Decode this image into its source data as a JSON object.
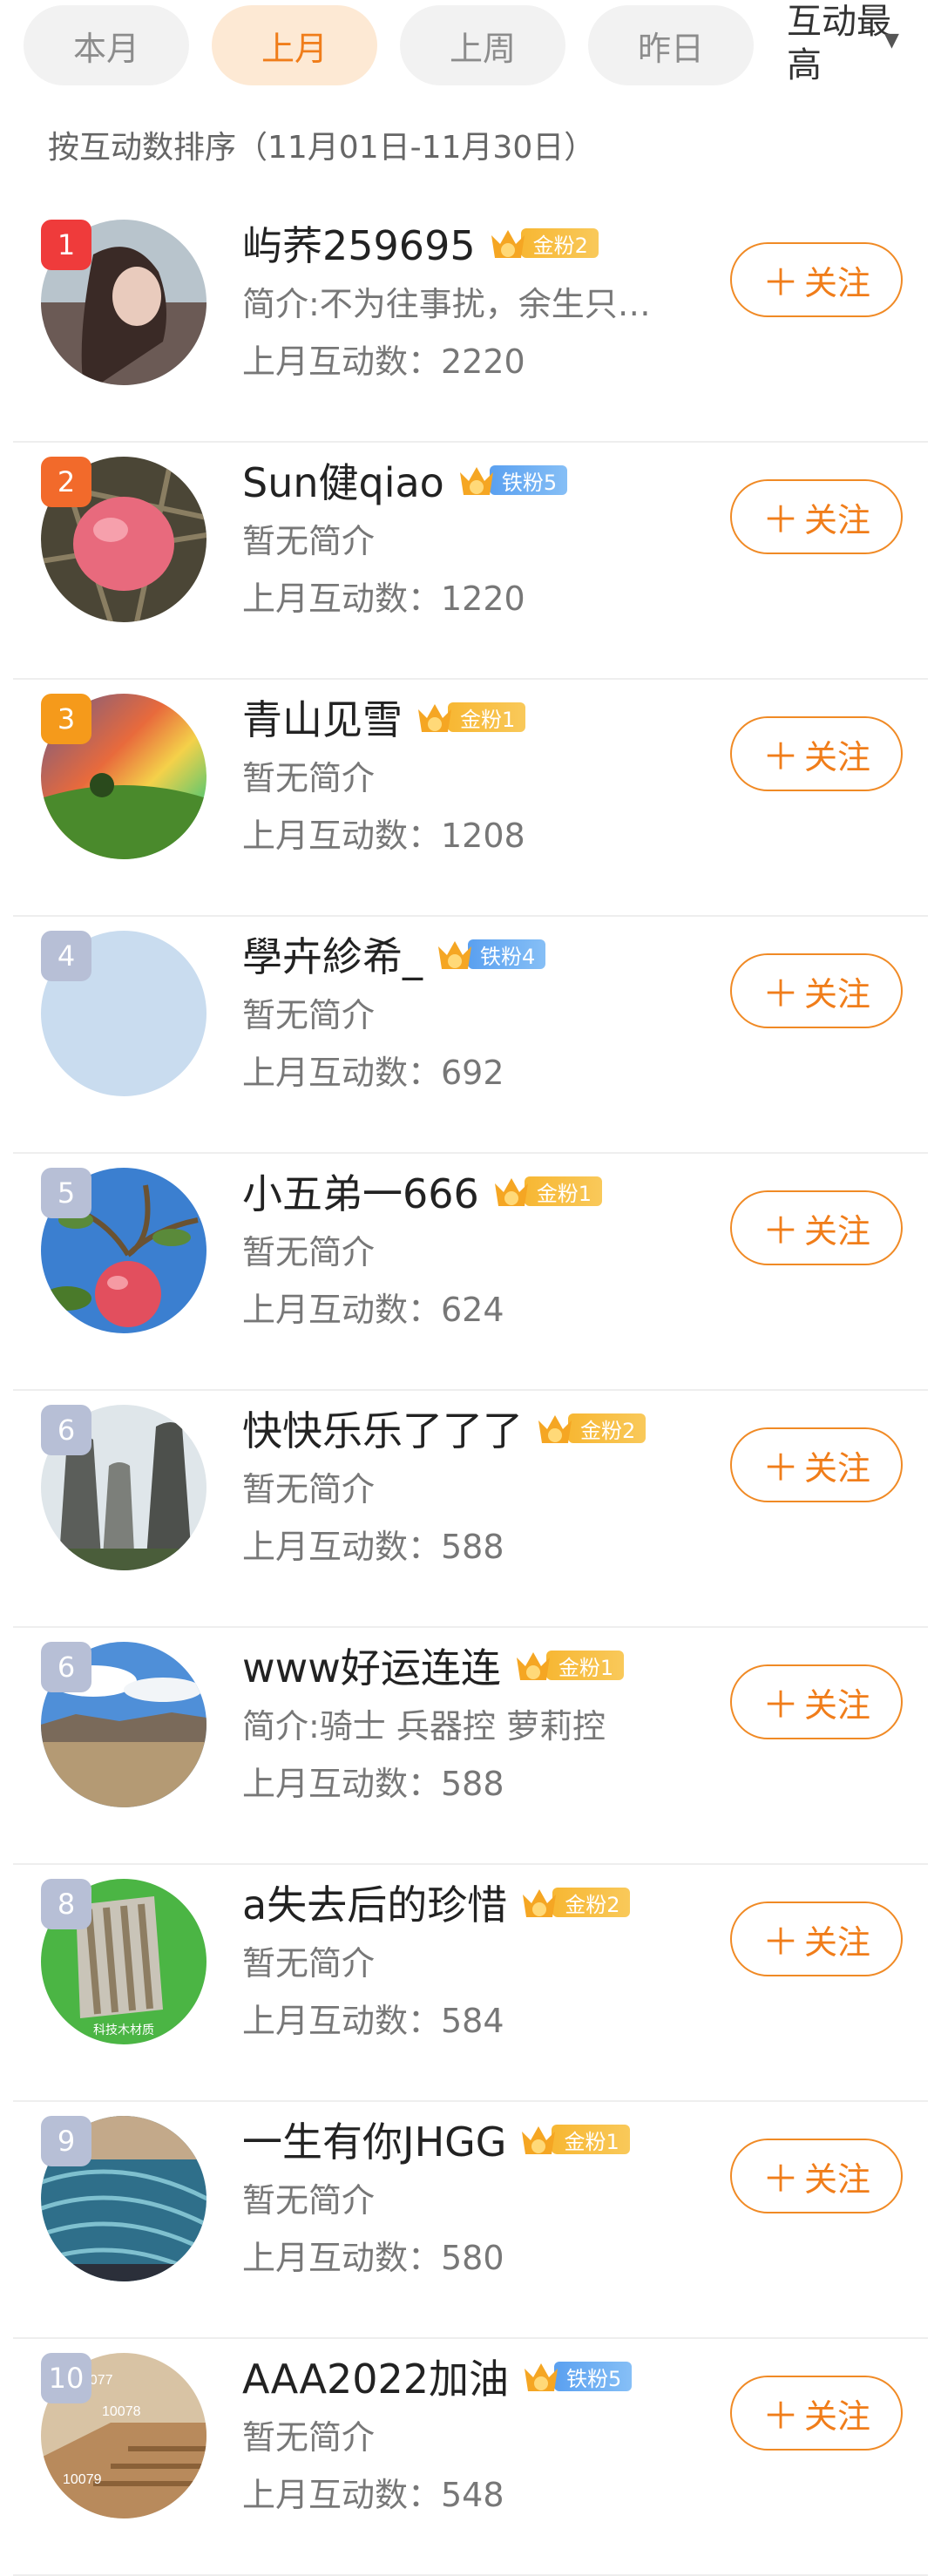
{
  "tabs": [
    {
      "label": "本月",
      "active": false
    },
    {
      "label": "上月",
      "active": true
    },
    {
      "label": "上周",
      "active": false
    },
    {
      "label": "昨日",
      "active": false
    }
  ],
  "sort": {
    "label": "互动最高",
    "icon": "caret-down-icon"
  },
  "subtitle": "按互动数排序（11月01日-11月30日）",
  "colors": {
    "accent": "#f07d1a",
    "tab_active_bg": "#fde9d4",
    "gold_badge": "#f7b733",
    "iron_badge": "#5aa0f0"
  },
  "list": [
    {
      "rank": "1",
      "name": "屿荞259695",
      "badge": "金粉2",
      "badge_type": "gold",
      "intro": "简介:不为往事扰，余生只…",
      "stat": "上月互动数：2220",
      "follow": "关注"
    },
    {
      "rank": "2",
      "name": "Sun健qiao",
      "badge": "铁粉5",
      "badge_type": "iron",
      "intro": "暂无简介",
      "stat": "上月互动数：1220",
      "follow": "关注"
    },
    {
      "rank": "3",
      "name": "青山见雪",
      "badge": "金粉1",
      "badge_type": "gold",
      "intro": "暂无简介",
      "stat": "上月互动数：1208",
      "follow": "关注"
    },
    {
      "rank": "4",
      "name": "學卉紾希_",
      "badge": "铁粉4",
      "badge_type": "iron",
      "intro": "暂无简介",
      "stat": "上月互动数：692",
      "follow": "关注"
    },
    {
      "rank": "5",
      "name": "小五弟一666",
      "badge": "金粉1",
      "badge_type": "gold",
      "intro": "暂无简介",
      "stat": "上月互动数：624",
      "follow": "关注"
    },
    {
      "rank": "6",
      "name": "快快乐乐了了了",
      "badge": "金粉2",
      "badge_type": "gold",
      "intro": "暂无简介",
      "stat": "上月互动数：588",
      "follow": "关注"
    },
    {
      "rank": "6",
      "name": "www好运连连",
      "badge": "金粉1",
      "badge_type": "gold",
      "intro": "简介:骑士 兵器控 萝莉控",
      "stat": "上月互动数：588",
      "follow": "关注"
    },
    {
      "rank": "8",
      "name": "a失去后的珍惜",
      "badge": "金粉2",
      "badge_type": "gold",
      "intro": "暂无简介",
      "stat": "上月互动数：584",
      "follow": "关注",
      "avatar_text": "科技木材质"
    },
    {
      "rank": "9",
      "name": "一生有你JHGG",
      "badge": "金粉1",
      "badge_type": "gold",
      "intro": "暂无简介",
      "stat": "上月互动数：580",
      "follow": "关注"
    },
    {
      "rank": "10",
      "name": "AAA2022加油",
      "badge": "铁粉5",
      "badge_type": "iron",
      "intro": "暂无简介",
      "stat": "上月互动数：548",
      "follow": "关注",
      "avatar_text": [
        "10077",
        "10078",
        "10079"
      ]
    }
  ]
}
